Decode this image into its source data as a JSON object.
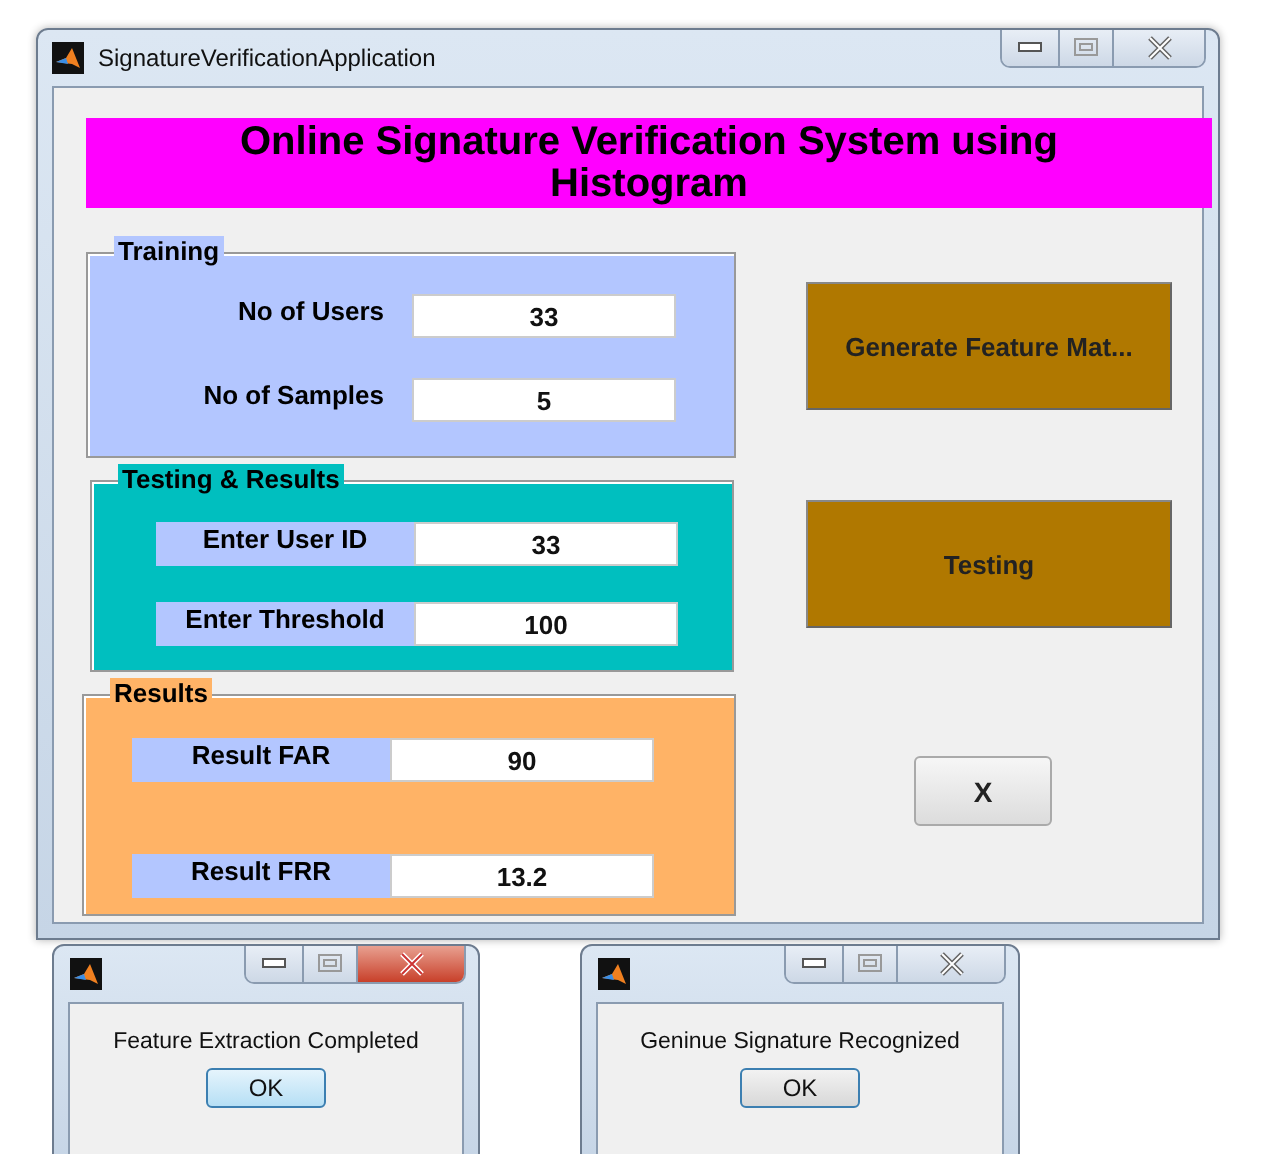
{
  "window": {
    "title": "SignatureVerificationApplication"
  },
  "banner": "Online Signature Verification System using Histogram",
  "panels": [
    {
      "title": "Training",
      "color": "#b3c6ff",
      "fields": [
        {
          "label": "No of Users",
          "value": "33"
        },
        {
          "label": "No of Samples",
          "value": "5"
        }
      ]
    },
    {
      "title": "Testing & Results",
      "color": "#00bfbf",
      "fields": [
        {
          "label": "Enter User ID",
          "value": "33"
        },
        {
          "label": "Enter Threshold",
          "value": "100"
        }
      ]
    },
    {
      "title": "Results",
      "color": "#ffb366",
      "fields": [
        {
          "label": "Result FAR",
          "value": "90"
        },
        {
          "label": "Result FRR",
          "value": "13.2"
        }
      ]
    }
  ],
  "buttons": [
    {
      "label": "Generate Feature Mat...",
      "kind": "action"
    },
    {
      "label": "Testing",
      "kind": "action"
    },
    {
      "label": "X",
      "kind": "close"
    }
  ],
  "dialogs": [
    {
      "message": "Feature Extraction Completed",
      "button": "OK",
      "focused": true,
      "close_hovered": true
    },
    {
      "message": "Geninue Signature Recognized",
      "button": "OK",
      "focused": false,
      "close_hovered": false
    }
  ]
}
